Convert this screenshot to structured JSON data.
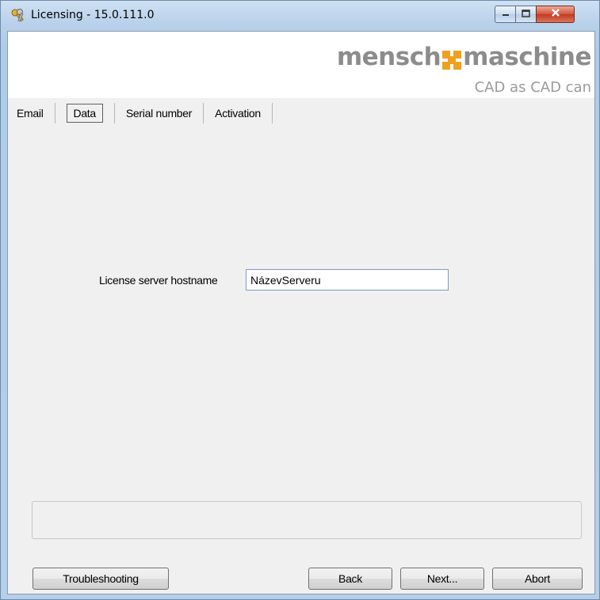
{
  "window": {
    "title": "Licensing - 15.0.111.0",
    "controls": {
      "minimize": "minimize-icon",
      "maximize": "maximize-icon",
      "close": "close-icon"
    }
  },
  "banner": {
    "brand_left": "mensch",
    "brand_right": "maschine",
    "tagline": "CAD as CAD can",
    "brand_color": "#8c8c8c",
    "accent_color": "#f0a020"
  },
  "tabs": [
    {
      "label": "Email",
      "active": false
    },
    {
      "label": "Data",
      "active": true
    },
    {
      "label": "Serial number",
      "active": false
    },
    {
      "label": "Activation",
      "active": false
    }
  ],
  "form": {
    "hostname_label": "License server hostname",
    "hostname_value": "NázevServeru"
  },
  "buttons": {
    "troubleshooting": "Troubleshooting",
    "back": "Back",
    "next": "Next...",
    "abort": "Abort"
  }
}
